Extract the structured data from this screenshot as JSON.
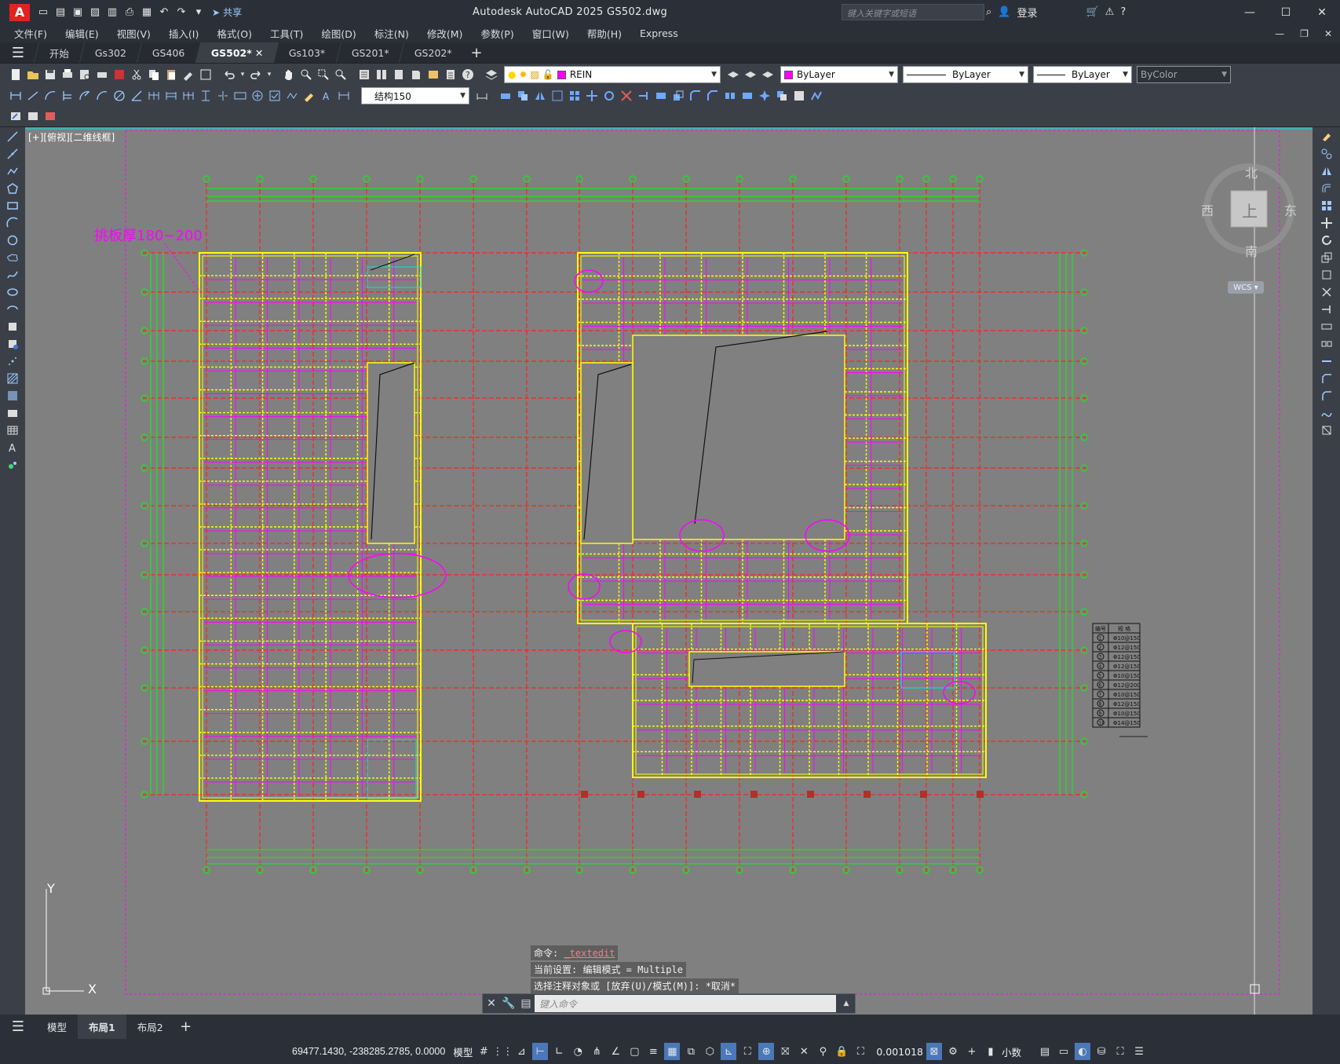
{
  "app": {
    "title": "Autodesk AutoCAD 2025    GS502.dwg",
    "logo_letter": "A",
    "share_label": "共享",
    "search_placeholder": "键入关键字或短语",
    "login_label": "登录"
  },
  "menus": [
    "文件(F)",
    "编辑(E)",
    "视图(V)",
    "插入(I)",
    "格式(O)",
    "工具(T)",
    "绘图(D)",
    "标注(N)",
    "修改(M)",
    "参数(P)",
    "窗口(W)",
    "帮助(H)",
    "Express"
  ],
  "file_tabs": [
    {
      "label": "开始",
      "active": false
    },
    {
      "label": "Gs302",
      "active": false
    },
    {
      "label": "GS406",
      "active": false
    },
    {
      "label": "GS502*",
      "active": true
    },
    {
      "label": "Gs103*",
      "active": false
    },
    {
      "label": "GS201*",
      "active": false
    },
    {
      "label": "GS202*",
      "active": false
    }
  ],
  "toolbar": {
    "layer_name": "REIN",
    "color": "ByLayer",
    "linetype": "ByLayer",
    "lineweight": "ByLayer",
    "plotstyle": "ByColor",
    "dimstyle": "结构150"
  },
  "viewport": {
    "label": "[+][俯视][二维线框]",
    "annotation": "挑板厚180~200",
    "ucs_x": "X",
    "ucs_y": "Y"
  },
  "viewcube": {
    "north": "北",
    "south": "南",
    "east": "东",
    "west": "西",
    "face": "上",
    "wcs": "WCS"
  },
  "command_history": {
    "line1_prefix": "命令: ",
    "line1_cmd": "_textedit",
    "line2": "当前设置: 编辑模式 = Multiple",
    "line3": "选择注释对象或 [放弃(U)/模式(M)]: *取消*"
  },
  "command_input": {
    "placeholder": "键入命令"
  },
  "layout_tabs": [
    {
      "label": "模型",
      "active": false
    },
    {
      "label": "布局1",
      "active": true
    },
    {
      "label": "布局2",
      "active": false
    }
  ],
  "status": {
    "coordinates": "69477.1430, -238285.2785, 0.0000",
    "space": "模型",
    "scale": "0.001018",
    "units": "小数"
  },
  "legend_table": {
    "header": [
      "编号",
      "规 格"
    ],
    "rows": [
      [
        "1",
        "Φ10@150"
      ],
      [
        "2",
        "Φ12@150"
      ],
      [
        "3",
        "Φ12@150"
      ],
      [
        "4",
        "Φ12@150"
      ],
      [
        "5",
        "Φ10@150"
      ],
      [
        "6",
        "Φ12@200"
      ],
      [
        "7",
        "Φ10@150"
      ],
      [
        "8",
        "Φ12@150"
      ],
      [
        "9",
        "Φ10@150"
      ],
      [
        "10",
        "Φ14@150"
      ]
    ]
  },
  "colors": {
    "grid_red": "#ff2020",
    "axis_green": "#00ff00",
    "slab_yellow": "#ffff00",
    "rebar_magenta": "#ff00ff",
    "cyan": "#00e5e5",
    "paper": "#808080"
  }
}
